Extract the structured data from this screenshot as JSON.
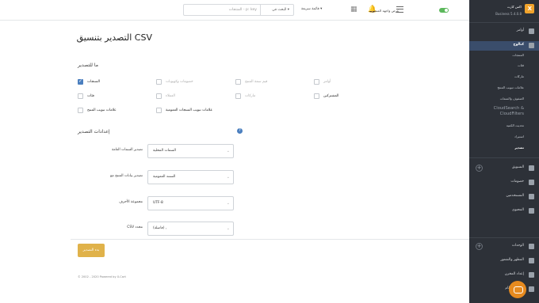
{
  "brand": {
    "name": "اکس کارت",
    "version": "Business 5.4.0.8",
    "logo_glyph": "X"
  },
  "topbar": {
    "quick_menu": "قائمة سريعة ▾",
    "search_scope": "البحث في ▾",
    "search_placeholder": "المنتجات - p: key",
    "storefront": "عرض واجهة المتجر",
    "language": "AR"
  },
  "sidebar": {
    "orders": "أوامر",
    "catalog": "كتالوج",
    "catalog_subs": [
      "المنتجات",
      "فئات",
      "ماركات",
      "علامات تبويب المنتج",
      "الصفوف والسمات"
    ],
    "cloudsearch": "CloudSearch & CloudFilters",
    "catalog_subs2": [
      "تحديث الكمية",
      "استيراد",
      "تصدير"
    ],
    "marketing": "التسويق",
    "discounts": "خصومات",
    "users": "المستخدمين",
    "content": "المحتوى",
    "addons": "الوحدات",
    "design": "المظهر والشعور",
    "store_setup": "إعداد المخزن",
    "system": "أدوات النظام"
  },
  "page": {
    "title": "التصدير بتنسيق CSV",
    "what_to_export": "ما للتصدير",
    "settings": "إعدادات التصدير",
    "export_button": "بدء التصدير",
    "copyright": "© 2002 - 2020 Powered by X-Cart"
  },
  "checkboxes": [
    {
      "label": "المنتجات",
      "checked": true,
      "enabled": true
    },
    {
      "label": "خصومات وكوبونات",
      "checked": false,
      "enabled": false
    },
    {
      "label": "قيم سمة المنتج",
      "checked": false,
      "enabled": false
    },
    {
      "label": "أوامر",
      "checked": false,
      "enabled": false
    },
    {
      "label": "فئات",
      "checked": false,
      "enabled": true
    },
    {
      "label": "العملاء",
      "checked": false,
      "enabled": false
    },
    {
      "label": "ماركات",
      "checked": false,
      "enabled": false
    },
    {
      "label": "المشتركين",
      "checked": false,
      "enabled": true
    },
    {
      "label": "علامات تبويب المنتج",
      "checked": false,
      "enabled": true
    },
    {
      "label": "علامات تبويب المنتجات العمومية",
      "checked": false,
      "enabled": true
    }
  ],
  "form": [
    {
      "label": "تصدير السمات العامة",
      "value": "السمات المحلية"
    },
    {
      "label": "تصدير بيانات المنتج مع",
      "value": "الستند العمومية"
    },
    {
      "label": "مجموعة الأحرف",
      "value": "UTF-8"
    },
    {
      "label": "CSV محدد",
      "value": "(فاصلة) ,"
    }
  ]
}
